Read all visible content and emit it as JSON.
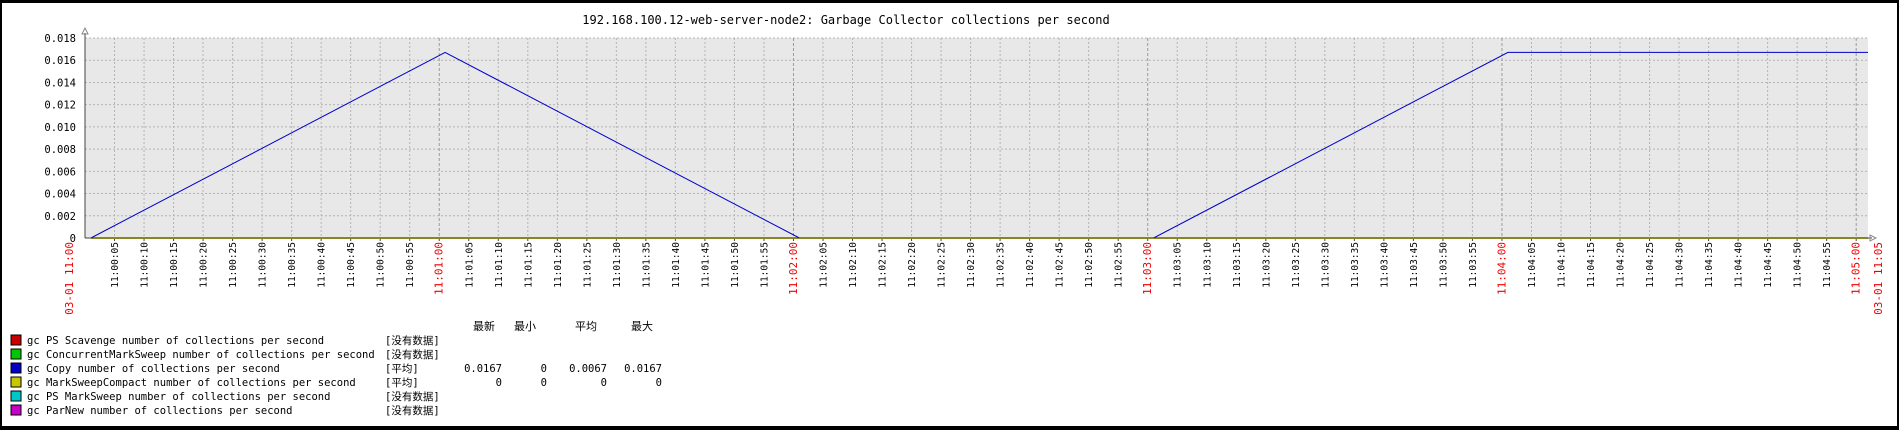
{
  "chart_data": {
    "type": "line",
    "title": "192.168.100.12-web-server-node2: Garbage Collector collections per second",
    "ylim": [
      0,
      0.018
    ],
    "y_ticks": [
      "0.018",
      "0.016",
      "0.014",
      "0.012",
      "0.010",
      "0.008",
      "0.006",
      "0.004",
      "0.002",
      "0"
    ],
    "x_start_label": "03-01 11:00",
    "x_end_label": "03-01 11:05",
    "x_ticks": [
      "11:00:05",
      "11:00:10",
      "11:00:15",
      "11:00:20",
      "11:00:25",
      "11:00:30",
      "11:00:35",
      "11:00:40",
      "11:00:45",
      "11:00:50",
      "11:00:55",
      "11:01:00",
      "11:01:05",
      "11:01:10",
      "11:01:15",
      "11:01:20",
      "11:01:25",
      "11:01:30",
      "11:01:35",
      "11:01:40",
      "11:01:45",
      "11:01:50",
      "11:01:55",
      "11:02:00",
      "11:02:05",
      "11:02:10",
      "11:02:15",
      "11:02:20",
      "11:02:25",
      "11:02:30",
      "11:02:35",
      "11:02:40",
      "11:02:45",
      "11:02:50",
      "11:02:55",
      "11:03:00",
      "11:03:05",
      "11:03:10",
      "11:03:15",
      "11:03:20",
      "11:03:25",
      "11:03:30",
      "11:03:35",
      "11:03:40",
      "11:03:45",
      "11:03:50",
      "11:03:55",
      "11:04:00",
      "11:04:05",
      "11:04:10",
      "11:04:15",
      "11:04:20",
      "11:04:25",
      "11:04:30",
      "11:04:35",
      "11:04:40",
      "11:04:45",
      "11:04:50",
      "11:04:55",
      "11:05:00"
    ],
    "major_ticks": [
      "11:01:00",
      "11:02:00",
      "11:03:00",
      "11:04:00",
      "11:05:00"
    ],
    "x_range_seconds": [
      0,
      302
    ],
    "series": [
      {
        "name": "gc Copy number of collections per second",
        "color": "#0000cc",
        "points": [
          [
            1,
            0
          ],
          [
            61,
            0.0167
          ],
          [
            121,
            0
          ],
          [
            181,
            0
          ],
          [
            241,
            0.0167
          ],
          [
            302,
            0.0167
          ]
        ]
      },
      {
        "name": "gc MarkSweepCompact number of collections per second",
        "color": "#c8c800",
        "points": [
          [
            1,
            0
          ],
          [
            302,
            0
          ]
        ]
      }
    ],
    "legend_headers": [
      "最新",
      "最小",
      "平均",
      "最大"
    ],
    "legend": [
      {
        "name": "gc PS Scavenge number of collections per second",
        "color": "#c80000",
        "func": "[没有数据]",
        "last": "",
        "min": "",
        "avg": "",
        "max": ""
      },
      {
        "name": "gc ConcurrentMarkSweep number of collections per second",
        "color": "#00c800",
        "func": "[没有数据]",
        "last": "",
        "min": "",
        "avg": "",
        "max": ""
      },
      {
        "name": "gc Copy number of collections per second",
        "color": "#0000c8",
        "func": "[平均]",
        "last": "0.0167",
        "min": "0",
        "avg": "0.0067",
        "max": "0.0167"
      },
      {
        "name": "gc MarkSweepCompact number of collections per second",
        "color": "#c8c800",
        "func": "[平均]",
        "last": "0",
        "min": "0",
        "avg": "0",
        "max": "0"
      },
      {
        "name": "gc PS MarkSweep number of collections per second",
        "color": "#00c8c8",
        "func": "[没有数据]",
        "last": "",
        "min": "",
        "avg": "",
        "max": ""
      },
      {
        "name": "gc ParNew number of collections per second",
        "color": "#c800c8",
        "func": "[没有数据]",
        "last": "",
        "min": "",
        "avg": "",
        "max": ""
      }
    ]
  }
}
